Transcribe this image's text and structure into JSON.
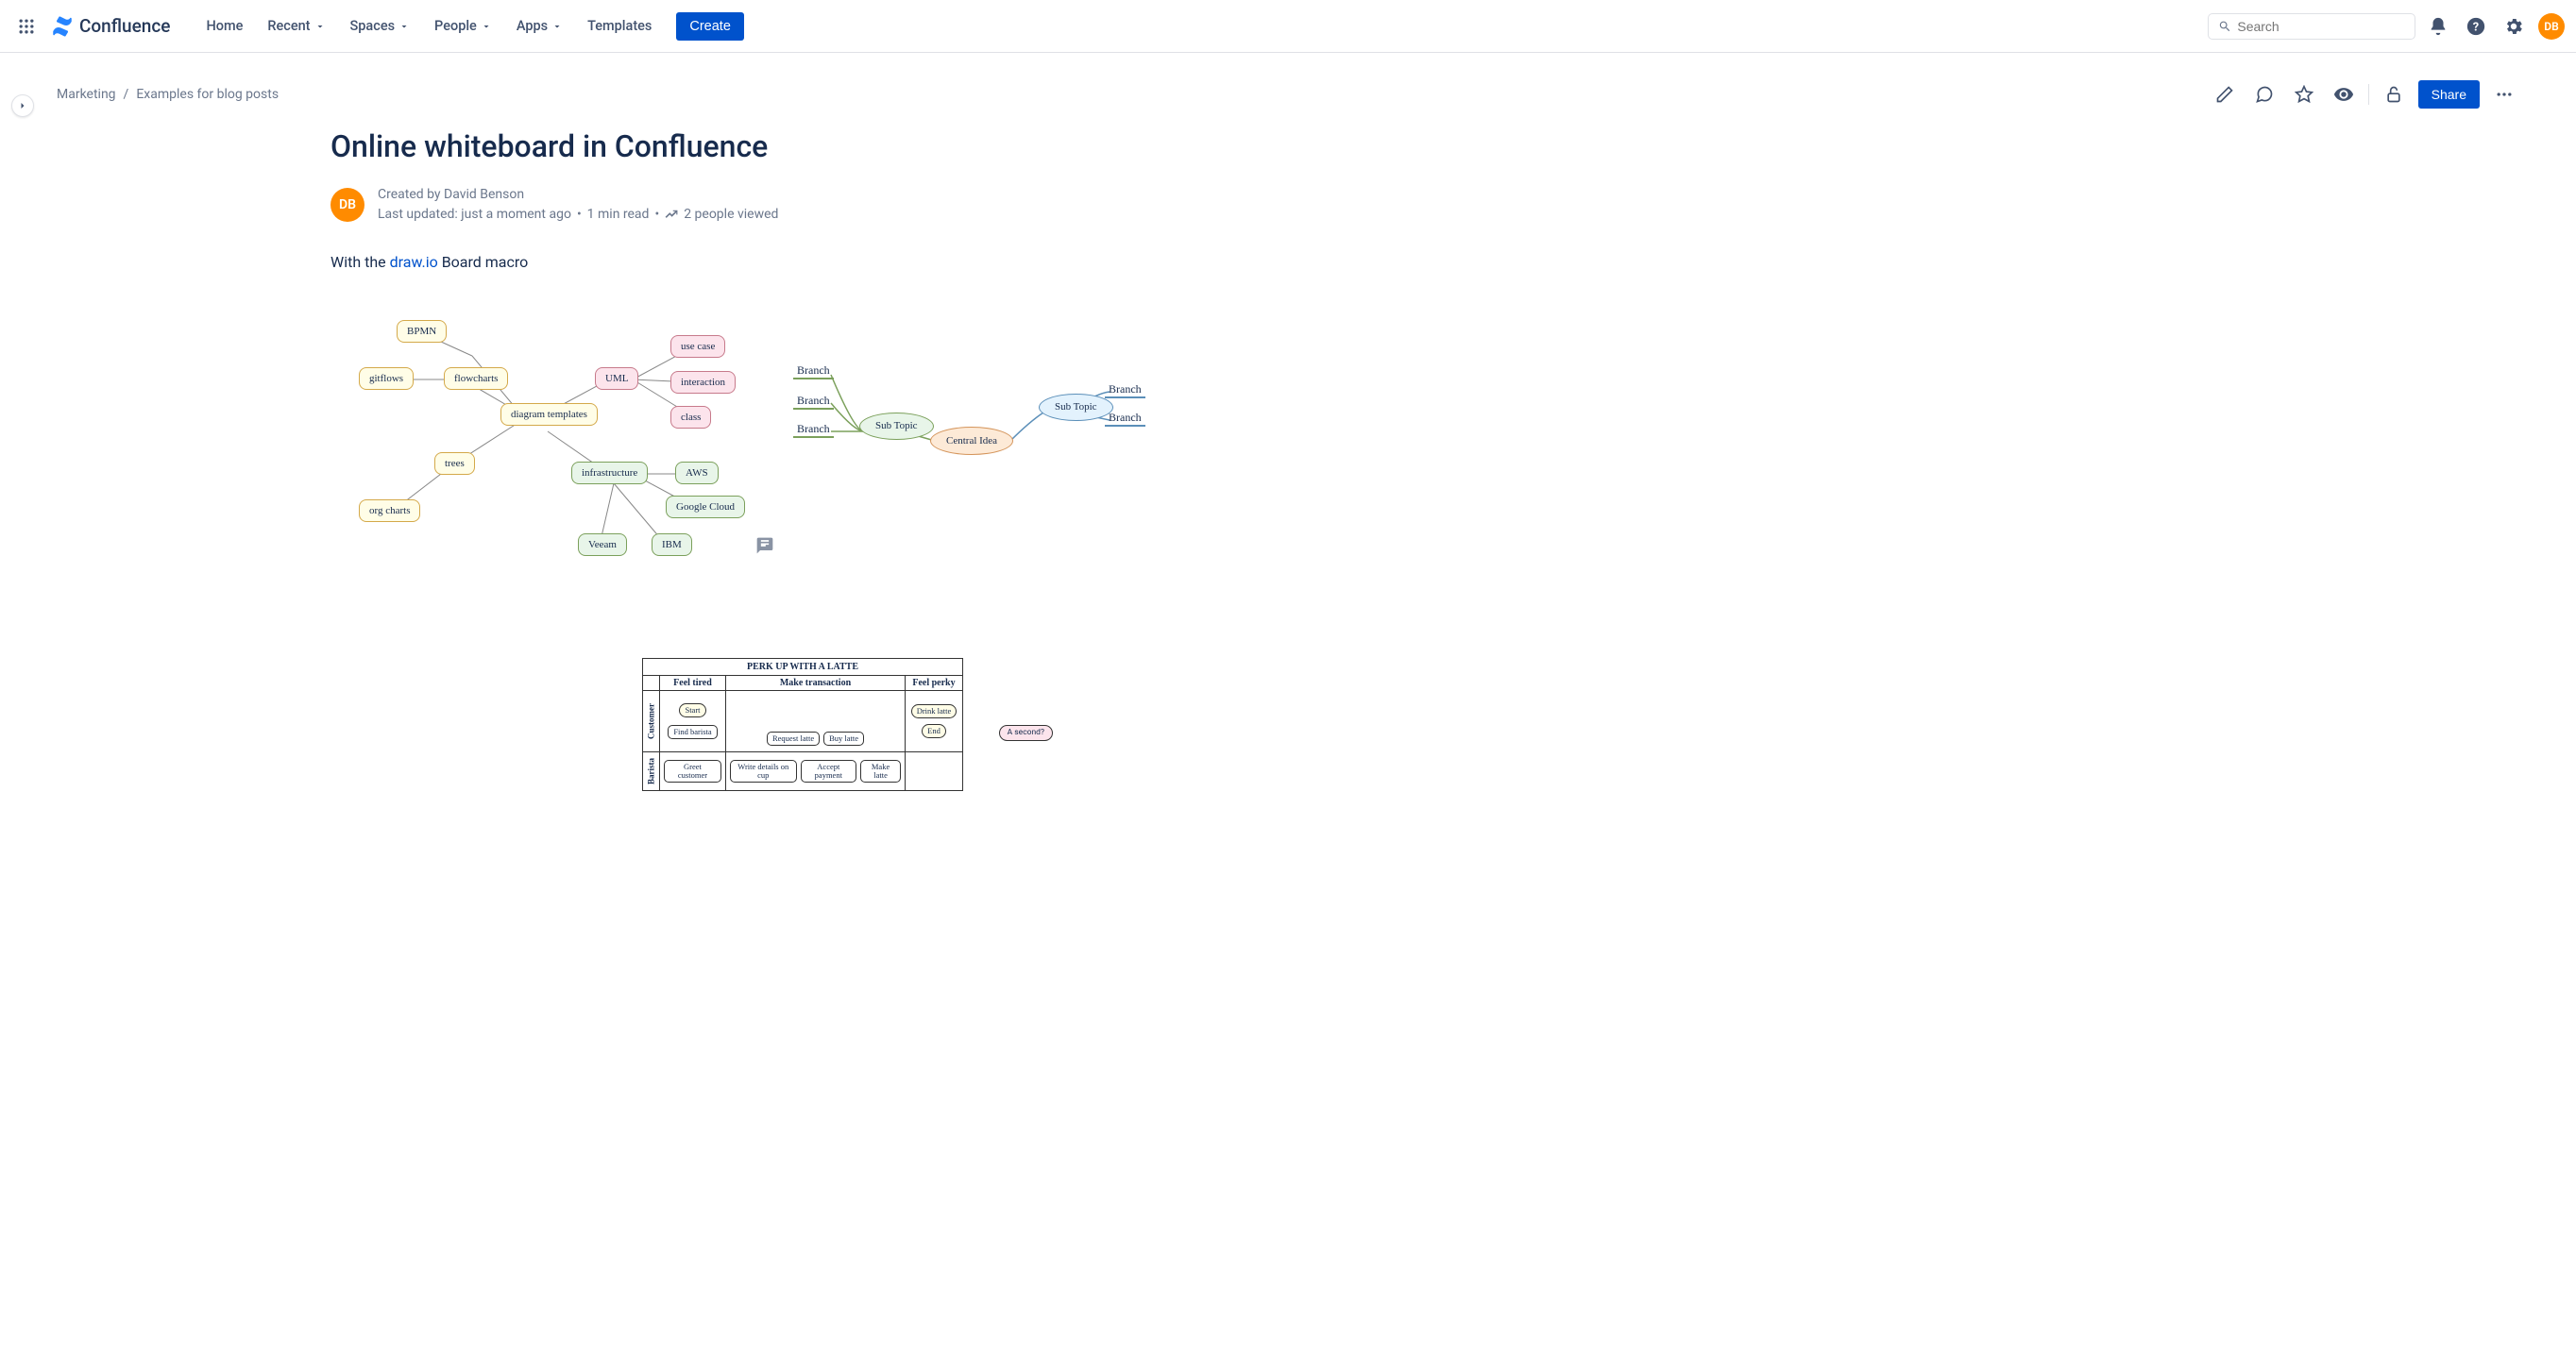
{
  "header": {
    "product": "Confluence",
    "nav": {
      "home": "Home",
      "recent": "Recent",
      "spaces": "Spaces",
      "people": "People",
      "apps": "Apps",
      "templates": "Templates"
    },
    "create": "Create",
    "search_placeholder": "Search",
    "avatar_initials": "DB"
  },
  "breadcrumbs": {
    "space": "Marketing",
    "sep": "/",
    "page": "Examples for blog posts"
  },
  "actions": {
    "share": "Share"
  },
  "page": {
    "title": "Online whiteboard in Confluence",
    "avatar_initials": "DB",
    "created_by": "Created by David Benson",
    "updated": "Last updated: just a moment ago",
    "dot": "•",
    "read": "1 min read",
    "viewed": "2 people viewed",
    "intro_prefix": "With the ",
    "intro_link": "draw.io",
    "intro_suffix": " Board macro"
  },
  "mindmap1": {
    "center": "diagram templates",
    "bpmn": "BPMN",
    "gitflows": "gitflows",
    "flowcharts": "flowcharts",
    "trees": "trees",
    "orgcharts": "org charts",
    "uml": "UML",
    "usecase": "use case",
    "interaction": "interaction",
    "class": "class",
    "infrastructure": "infrastructure",
    "aws": "AWS",
    "gcloud": "Google Cloud",
    "veeam": "Veeam",
    "ibm": "IBM"
  },
  "mindmap2": {
    "central": "Central Idea",
    "sub1": "Sub Topic",
    "sub2": "Sub Topic",
    "b1": "Branch",
    "b2": "Branch",
    "b3": "Branch",
    "b4": "Branch",
    "b5": "Branch"
  },
  "swim": {
    "title": "Perk up with a latte",
    "cols": {
      "c1": "Feel tired",
      "c2": "Make transaction",
      "c3": "Feel perky"
    },
    "roles": {
      "r1": "Customer",
      "r2": "Barista"
    },
    "n": {
      "start": "Start",
      "find": "Find barista",
      "req": "Request latte",
      "buy": "Buy latte",
      "drink": "Drink latte",
      "end": "End",
      "greet": "Greet customer",
      "write": "Write details on cup",
      "accept": "Accept payment",
      "make": "Make latte",
      "second": "A second?"
    }
  }
}
